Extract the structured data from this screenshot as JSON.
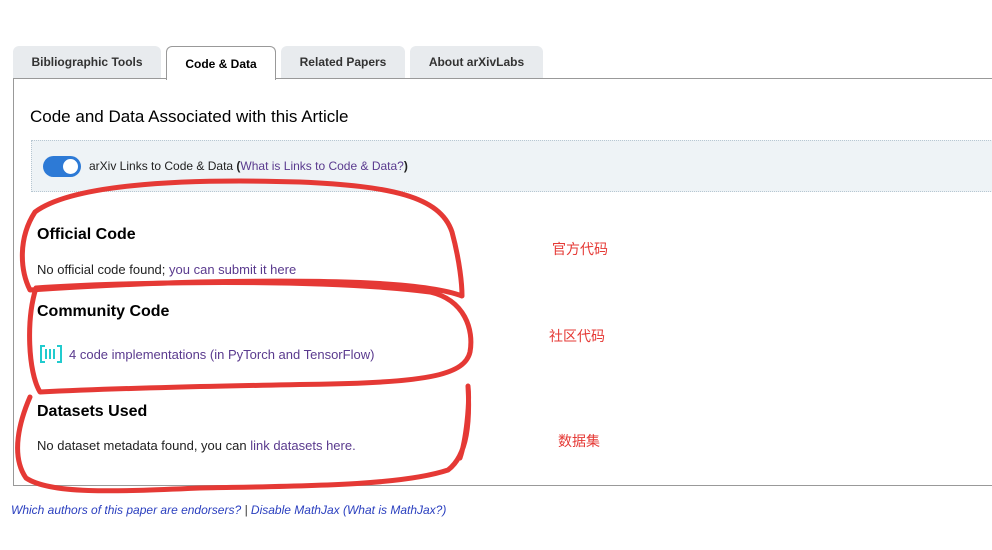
{
  "tabs": [
    {
      "label": "Bibliographic Tools",
      "active": false
    },
    {
      "label": "Code & Data",
      "active": true
    },
    {
      "label": "Related Papers",
      "active": false
    },
    {
      "label": "About arXivLabs",
      "active": false
    }
  ],
  "panel": {
    "title": "Code and Data Associated with this Article",
    "toggle": {
      "on": true,
      "label": "arXiv Links to Code & Data",
      "open_paren": "(",
      "help_link": "What is Links to Code & Data?",
      "close_paren": ")"
    },
    "official": {
      "title": "Official Code",
      "text": "No official code found; ",
      "link": "you can submit it here"
    },
    "community": {
      "title": "Community Code",
      "icon": "papers-with-code-icon",
      "link": "4 code implementations (in PyTorch and TensorFlow)"
    },
    "datasets": {
      "title": "Datasets Used",
      "text": "No dataset metadata found, you can ",
      "link": "link datasets here."
    }
  },
  "footer": {
    "endorsers_link": "Which authors of this paper are endorsers?",
    "separator": " | ",
    "mathjax_link": "Disable MathJax",
    "mathjax_help": "(What is MathJax?)"
  },
  "annotations": {
    "official": "官方代码",
    "community": "社区代码",
    "datasets": "数据集",
    "color": "#e53935"
  },
  "colors": {
    "accent": "#2d7ad6",
    "link": "#5a3a8e",
    "footer_link": "#2a3fbf"
  }
}
